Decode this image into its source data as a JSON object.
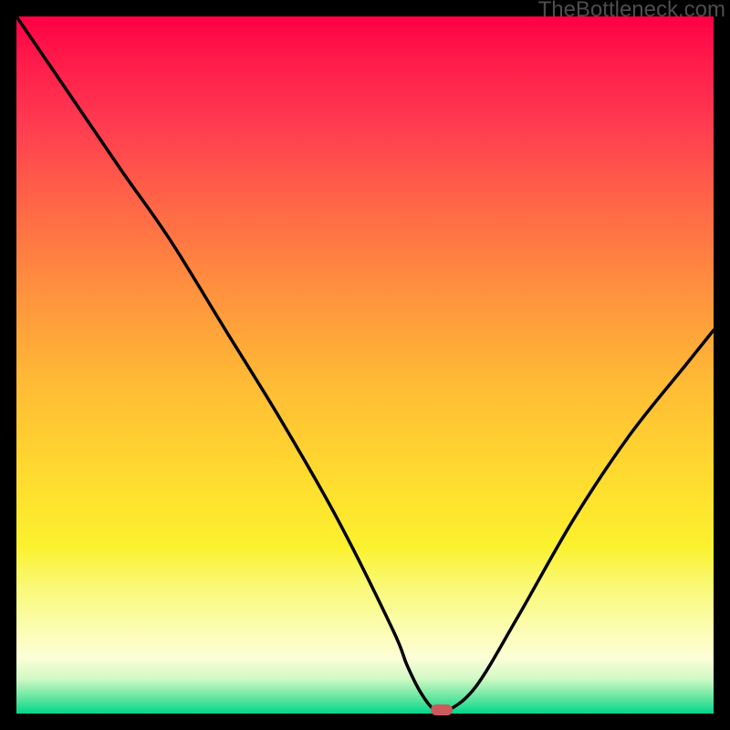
{
  "watermark": "TheBottleneck.com",
  "chart_data": {
    "type": "line",
    "title": "",
    "xlabel": "",
    "ylabel": "",
    "xlim": [
      0,
      100
    ],
    "ylim": [
      0,
      100
    ],
    "background_gradient": {
      "top": "#ff0044",
      "mid": "#ffd52e",
      "bottom": "#00d68a"
    },
    "series": [
      {
        "name": "bottleneck-curve",
        "color": "#000000",
        "x": [
          0.0,
          7.5,
          15.0,
          22.0,
          30.0,
          38.0,
          46.0,
          54.0,
          56.0,
          58.0,
          60.0,
          62.0,
          66.0,
          72.0,
          80.0,
          88.0,
          96.0,
          100.0
        ],
        "y": [
          100.0,
          89.0,
          78.0,
          68.0,
          55.0,
          42.0,
          28.0,
          12.0,
          7.0,
          3.0,
          0.5,
          0.5,
          4.0,
          14.0,
          28.0,
          40.0,
          50.0,
          55.0
        ]
      }
    ],
    "marker": {
      "name": "optimal-point",
      "x": 61.0,
      "y": 0.5,
      "color": "#cb5a5f"
    },
    "grid": false,
    "legend": false
  }
}
